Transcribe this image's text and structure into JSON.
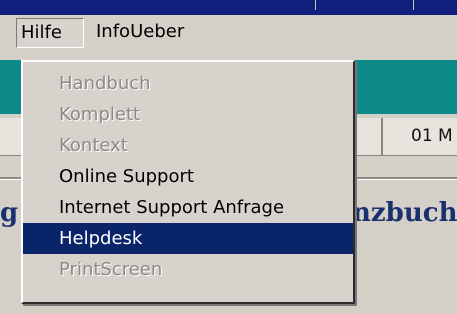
{
  "menubar": {
    "hilfe_label": "Hilfe",
    "infoueber_label": "InfoUeber"
  },
  "background": {
    "ribbon_text": "01 M",
    "left_text": "g",
    "right_text": "nzbuch"
  },
  "dropdown": {
    "items": [
      {
        "label": "Handbuch",
        "state": "disabled"
      },
      {
        "label": "Komplett",
        "state": "disabled"
      },
      {
        "label": "Kontext",
        "state": "disabled"
      },
      {
        "label": "Online Support",
        "state": "enabled"
      },
      {
        "label": "Internet Support Anfrage",
        "state": "enabled"
      },
      {
        "label": "Helpdesk",
        "state": "highlighted"
      },
      {
        "label": "PrintScreen",
        "state": "disabled"
      }
    ]
  },
  "colors": {
    "title_bar": "#111f7c",
    "teal_band": "#0c8a89",
    "highlight": "#0a246a",
    "disabled_text": "#8d8a86"
  }
}
